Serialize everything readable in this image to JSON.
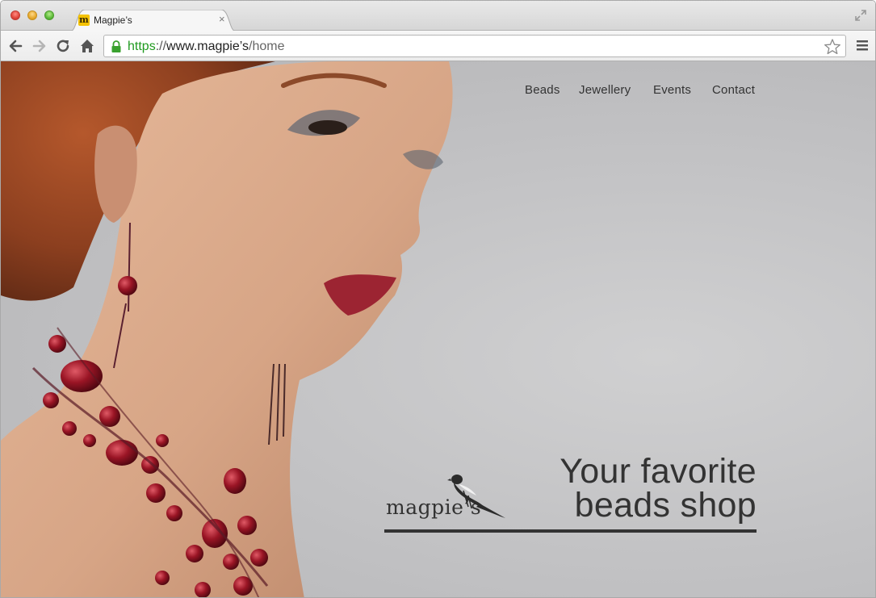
{
  "browser": {
    "tab": {
      "title": "Magpie’s",
      "favicon_letter": "m",
      "close_glyph": "×"
    },
    "url": {
      "scheme": "https",
      "separator": "://",
      "host": "www.magpie’s",
      "path": "/home"
    }
  },
  "site": {
    "nav": [
      {
        "label": "Beads"
      },
      {
        "label": "Jewellery"
      },
      {
        "label": "Events"
      },
      {
        "label": "Contact"
      }
    ],
    "hero": {
      "line1": "Your favorite",
      "line2": "beads shop"
    },
    "logo": {
      "text": "magpie’s",
      "icon": "magpie-bird-icon"
    }
  },
  "colors": {
    "url_scheme": "#1f9a1f",
    "text_dark": "#333333",
    "background": "#c3c3c5",
    "favicon": "#f4c200"
  }
}
